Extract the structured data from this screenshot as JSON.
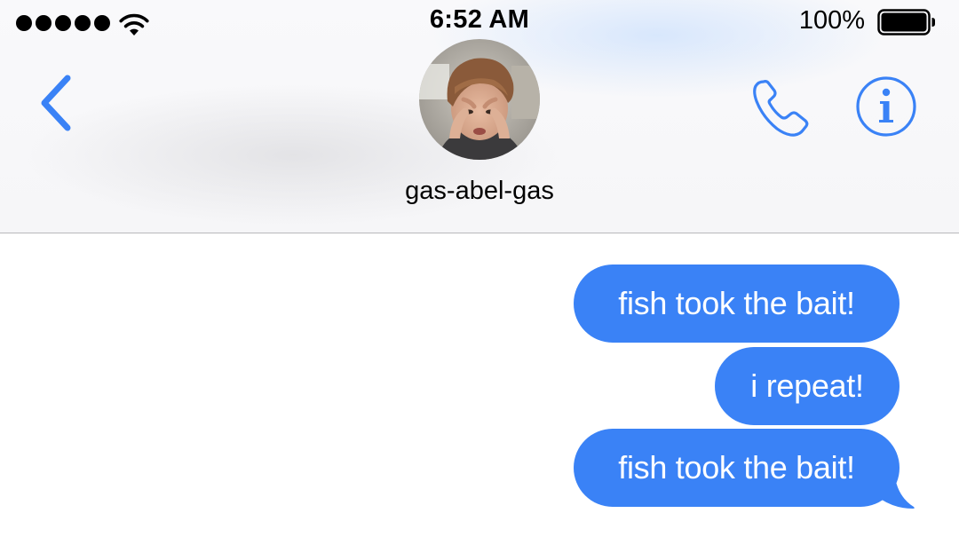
{
  "status_bar": {
    "signal_bars": 5,
    "time": "6:52 AM",
    "battery_percent": "100%",
    "battery_level": 1.0,
    "icons": [
      "signal-dots-icon",
      "wifi-icon",
      "battery-icon"
    ]
  },
  "nav": {
    "back_icon": "chevron-left-icon",
    "call_icon": "phone-icon",
    "info_icon": "info-icon",
    "accent_color": "#3a82f6"
  },
  "contact": {
    "name": "gas-abel-gas"
  },
  "messages": [
    {
      "text": "fish took the bait!",
      "direction": "outgoing"
    },
    {
      "text": "i repeat!",
      "direction": "outgoing"
    },
    {
      "text": "fish took the bait!",
      "direction": "outgoing"
    }
  ],
  "colors": {
    "bubble": "#3a82f6",
    "bubble_text": "#ffffff"
  }
}
